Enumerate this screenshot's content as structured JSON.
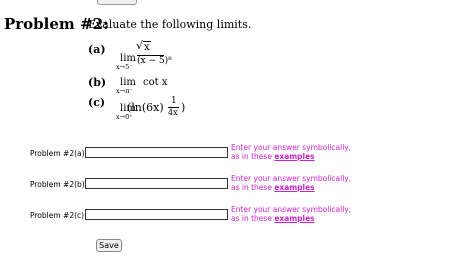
{
  "problem": {
    "heading": "Problem #2:",
    "intro": "Evaluate the following limits."
  },
  "parts": {
    "a": {
      "label": "(a)",
      "lim": "lim",
      "sub": "x→5⁻",
      "numerator": "x",
      "denominator": "(x − 5)⁸"
    },
    "b": {
      "label": "(b)",
      "lim": "lim",
      "sub": "x→π⁻",
      "expr": "cot x"
    },
    "c": {
      "label": "(c)",
      "lim": "lim",
      "sub": "x→0⁺",
      "open": "(ln(6x) −",
      "frac_num": "1",
      "frac_den": "4x",
      "close": ")"
    }
  },
  "answers": [
    {
      "label": "Problem #2(a):",
      "value": "",
      "hint_line1": "Enter your answer symbolically,",
      "hint_line2": "as in these ",
      "hint_link": "examples"
    },
    {
      "label": "Problem #2(b):",
      "value": "",
      "hint_line1": "Enter your answer symbolically,",
      "hint_line2": "as in these ",
      "hint_link": "examples"
    },
    {
      "label": "Problem #2(c):",
      "value": "",
      "hint_line1": "Enter your answer symbolically,",
      "hint_line2": "as in these ",
      "hint_link": "examples"
    }
  ],
  "save_label": "Save",
  "colors": {
    "hint": "#cc22cc"
  }
}
